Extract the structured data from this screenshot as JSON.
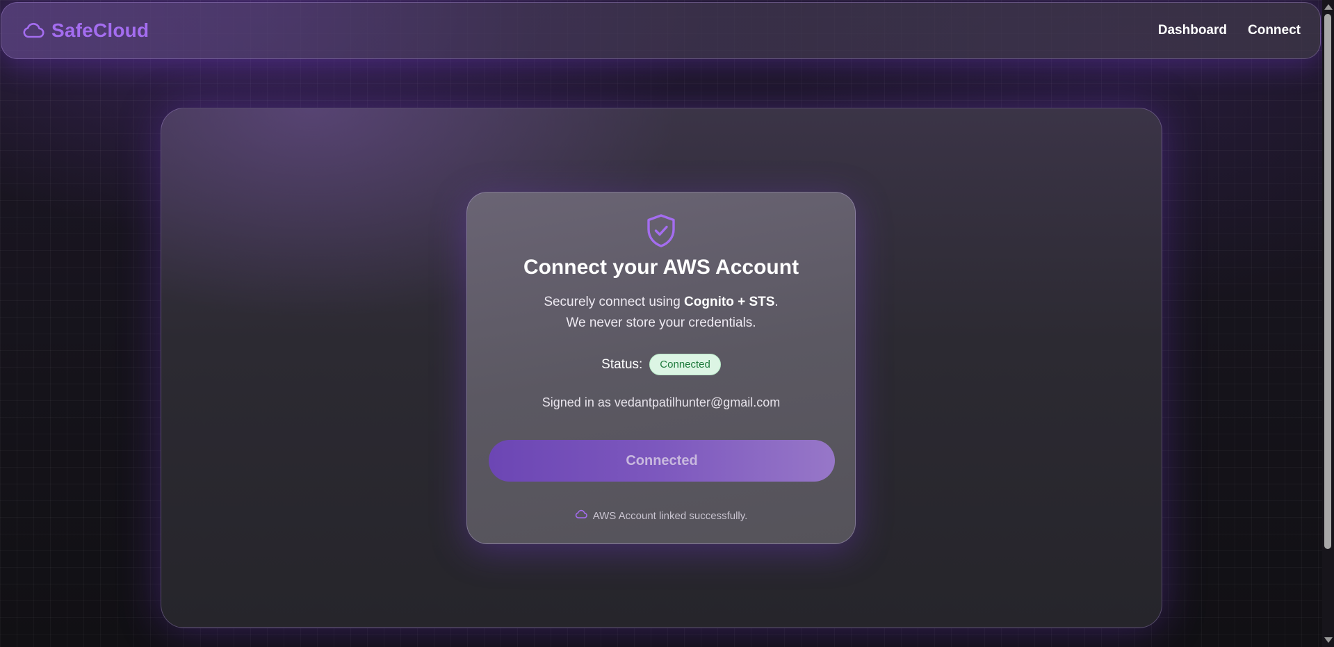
{
  "app": {
    "brand_name": "SafeCloud",
    "brand_icon": "cloud-icon",
    "brand_color": "#a46df0"
  },
  "nav": {
    "links": [
      {
        "label": "Dashboard"
      },
      {
        "label": "Connect"
      }
    ]
  },
  "card": {
    "icon": "shield-check-icon",
    "title": "Connect your AWS Account",
    "subtitle_prefix": "Securely connect using ",
    "subtitle_bold": "Cognito + STS",
    "subtitle_suffix": ".",
    "subtitle_line2": "We never store your credentials.",
    "status_label": "Status:",
    "status_value": "Connected",
    "status_color": "#1e7a3c",
    "signed_in_text": "Signed in as vedantpatilhunter@gmail.com",
    "button_label": "Connected",
    "footer_icon": "cloud-icon",
    "footer_text": "AWS Account linked successfully."
  }
}
